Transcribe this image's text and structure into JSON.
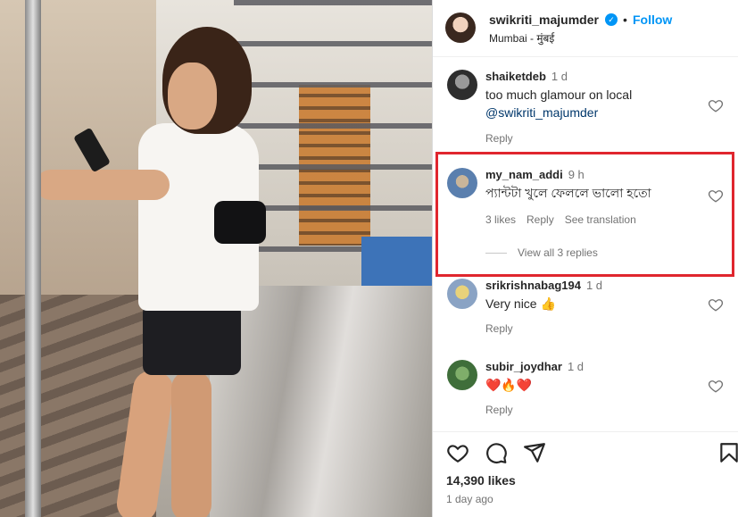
{
  "post": {
    "author": "swikriti_majumder",
    "verified_glyph": "✓",
    "separator": "•",
    "follow_label": "Follow",
    "location": "Mumbai - मुंबई"
  },
  "comments": [
    {
      "user": "shaiketdeb",
      "time": "1 d",
      "text": "too much glamour on local",
      "mention": "@swikriti_majumder",
      "reply_label": "Reply"
    },
    {
      "user": "my_nam_addi",
      "time": "9 h",
      "text": "প্যান্টটা খুলে ফেললে ভালো হতো",
      "likes_label": "3 likes",
      "reply_label": "Reply",
      "translate_label": "See translation",
      "view_replies_label": "View all 3 replies"
    },
    {
      "user": "srikrishnabag194",
      "time": "1 d",
      "text": "Very nice 👍",
      "reply_label": "Reply"
    },
    {
      "user": "subir_joydhar",
      "time": "1 d",
      "text": "❤️🔥❤️",
      "reply_label": "Reply"
    }
  ],
  "footer": {
    "likes": "14,390 likes",
    "time_ago": "1 day ago"
  },
  "icons": {
    "like": "heart-icon",
    "comment": "comment-icon",
    "share": "send-icon",
    "save": "bookmark-icon",
    "verified": "verified-badge-icon"
  },
  "colors": {
    "accent": "#0095f6",
    "highlight_border": "#e0262e",
    "secondary_text": "#737373"
  }
}
